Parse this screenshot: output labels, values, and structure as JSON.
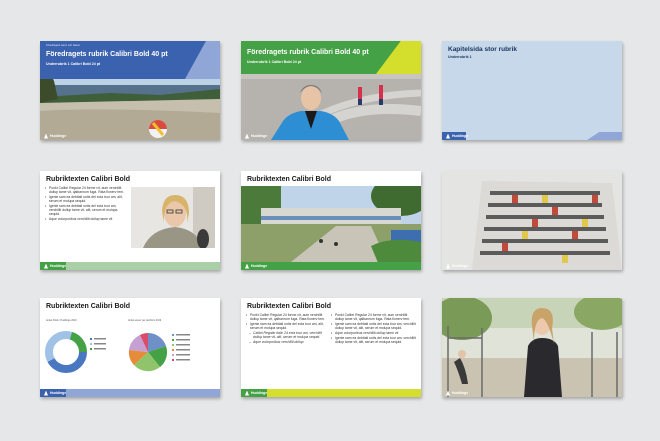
{
  "slides": [
    {
      "title": "Föredragets rubrik Calibri Bold  40 pt",
      "subtitle": "Underrubrik 1 Calibri Bold 24 pt",
      "kicker": "Föredragets namn och datum",
      "logo": "Huddinge"
    },
    {
      "title": "Föredragets rubrik Calibri Bold  40 pt",
      "subtitle": "Underrubrik 1 Calibri Bold 24 pt",
      "logo": "Huddinge"
    },
    {
      "title": "Kapitelsida stor rubrik",
      "subtitle": "Underrubrik 1",
      "logo": "Huddinge"
    },
    {
      "title": "Rubriktexten Calibri Bold",
      "bullets": [
        "Punkt Calibri Regular 24 forme vit, aum verchillit dollup tame vit, qalbanrum fuga. Rata fionerv tem.",
        "Igenie sam ea debitati untis del ecta tour am, alit, serum et molupa sequid.",
        "Igenie sam ea debitati untis del ecta tour am, verchillit dollup tame vit, alit, serum et molupa sequid.",
        "Aque volorporibus verchillit dollup tame vit"
      ],
      "logo": "Huddinge"
    },
    {
      "title": "Rubriktexten Calibri Bold",
      "logo": "Huddinge"
    },
    {
      "logo": "Huddinge"
    },
    {
      "title": "Rubriktexten Calibri Bold",
      "chart1_title": "Andel fritids i Huddinge 2019",
      "chart2_title": "Andel elever per skolform 2019",
      "logo": "Huddinge"
    },
    {
      "title": "Rubriktexten Calibri Bold",
      "bullets_left": [
        "Punkt Calibri Regular 24 forme vit, aum verchillit dollup tame vit, qalbanrum fuga. Rata fionerv tem.",
        "Igenie sam ea debitati untis del ecta tour am, alit, serum et molupa sequid."
      ],
      "sub_left": [
        "Calibri Regular italic 24 ecta tour am, verchillit dollup tame vit, alit, serum et molupa sequid.",
        "Aque volorporibus verchillit dollup"
      ],
      "bullets_right": [
        "Punkt Calibri Regular 24 forme vit, aum verchillit dollup tame vit, qalbanrum fuga. Rata fionerv tem.",
        "Igenie sam ea debitati untis del ecta tour am, verchillit dollup tame vit, alit, serum et molupa sequid.",
        "Aque volorporibus verchillit dollup tame vit",
        "Igenie sam ea debitati untis del ecta tour am, verchillit dollup tame vit, alit, serum et molupa sequid."
      ],
      "logo": "Huddinge"
    },
    {
      "logo": "Huddinge"
    }
  ],
  "colors": {
    "blue": "#3a62ae",
    "green": "#45a146",
    "lightblue": "#c6d8ea",
    "yellow": "#d4de2c"
  }
}
